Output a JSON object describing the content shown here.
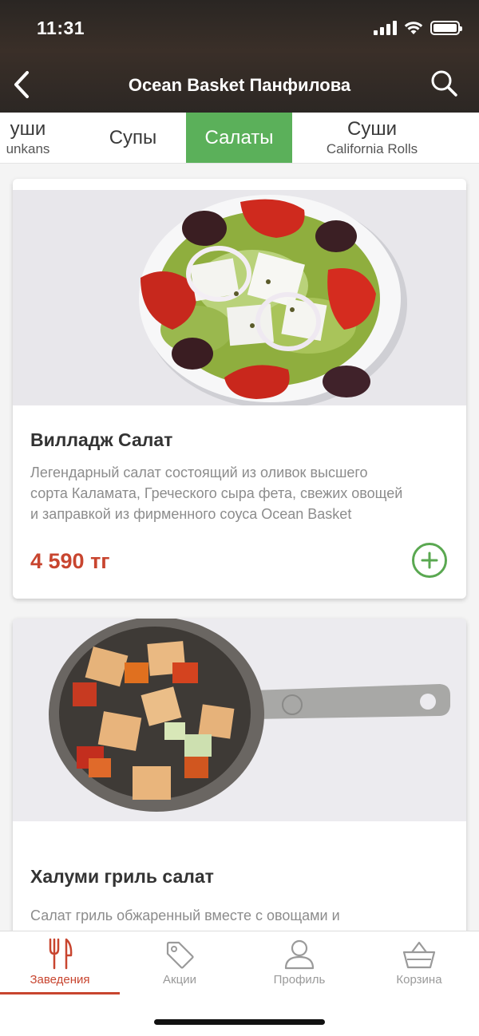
{
  "status_bar": {
    "time": "11:31"
  },
  "nav": {
    "title": "Ocean Basket Панфилова"
  },
  "categories": [
    {
      "main": "уши",
      "sub": "unkans"
    },
    {
      "main": "Супы",
      "sub": ""
    },
    {
      "main": "Салаты",
      "sub": "",
      "active": true
    },
    {
      "main": "Суши",
      "sub": "California Rolls"
    }
  ],
  "products": [
    {
      "name": "Вилладж Салат",
      "description": "Легендарный салат состоящий из оливок высшего сорта Каламата, Греческого сыра фета, свежих овощей и заправкой из фирменного соуса Ocean Basket",
      "price": "4 590 тг"
    },
    {
      "name": "Халуми гриль салат",
      "description": "Салат гриль обжаренный вместе с овощами и"
    }
  ],
  "tabbar": [
    {
      "label": "Заведения",
      "icon": "cutlery-icon",
      "active": true
    },
    {
      "label": "Акции",
      "icon": "tag-icon"
    },
    {
      "label": "Профиль",
      "icon": "profile-icon"
    },
    {
      "label": "Корзина",
      "icon": "basket-icon"
    }
  ],
  "colors": {
    "accent_green": "#5bb05a",
    "price_red": "#c8452f",
    "header_dark": "#2c2724"
  }
}
